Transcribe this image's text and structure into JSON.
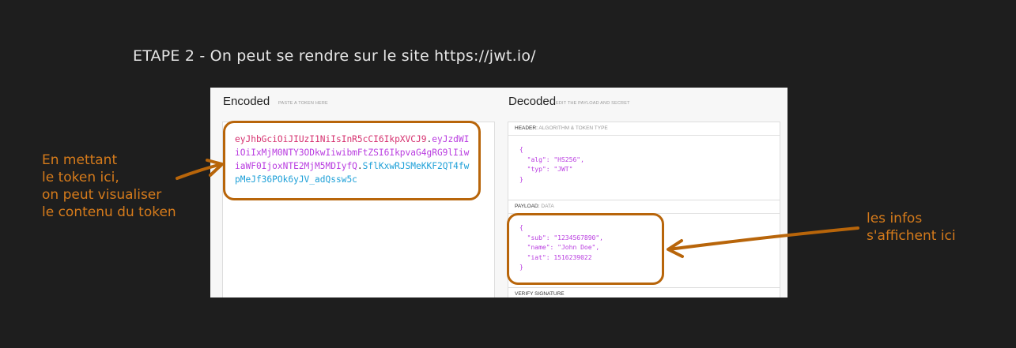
{
  "heading": "ETAPE 2 - On peut se rendre sur le site https://jwt.io/",
  "encoded": {
    "title": "Encoded",
    "subtitle": "PASTE A TOKEN HERE",
    "token_header": "eyJhbGciOiJIUzI1NiIsInR5cCI6IkpXVCJ9",
    "token_payload": "eyJzdWIiOiIxMjM0NTY3ODkwIiwibmFtZSI6IkpvaG4gRG9lIiwiaWF0IjoxNTE2MjM5MDIyfQ",
    "token_signature": "SflKxwRJSMeKKF2QT4fwpMeJf36POk6yJV_adQssw5c",
    "separator": "."
  },
  "decoded": {
    "title": "Decoded",
    "subtitle": "EDIT THE PAYLOAD AND SECRET",
    "header_panel": {
      "label": "HEADER:",
      "sublabel": "ALGORITHM & TOKEN TYPE",
      "open": "{",
      "lines": [
        "\"alg\": \"HS256\",",
        "\"typ\": \"JWT\""
      ],
      "close": "}"
    },
    "payload_panel": {
      "label": "PAYLOAD:",
      "sublabel": "DATA",
      "open": "{",
      "lines": [
        "\"sub\": \"1234567890\",",
        "\"name\": \"John Doe\",",
        "\"iat\": 1516239022"
      ],
      "close": "}"
    },
    "verify_panel": {
      "label": "VERIFY SIGNATURE"
    }
  },
  "annotations": {
    "left_note": [
      "En mettant",
      "le token ici,",
      "on peut visualiser",
      "le contenu du token"
    ],
    "right_note": [
      "les infos",
      "s'affichent ici"
    ]
  },
  "colors": {
    "background": "#1e1e1e",
    "annotation": "#d67b1b",
    "box_outline": "#b8650a",
    "token_header": "#d6316f",
    "token_payload": "#b93ce0",
    "token_signature": "#1ea0d8"
  }
}
